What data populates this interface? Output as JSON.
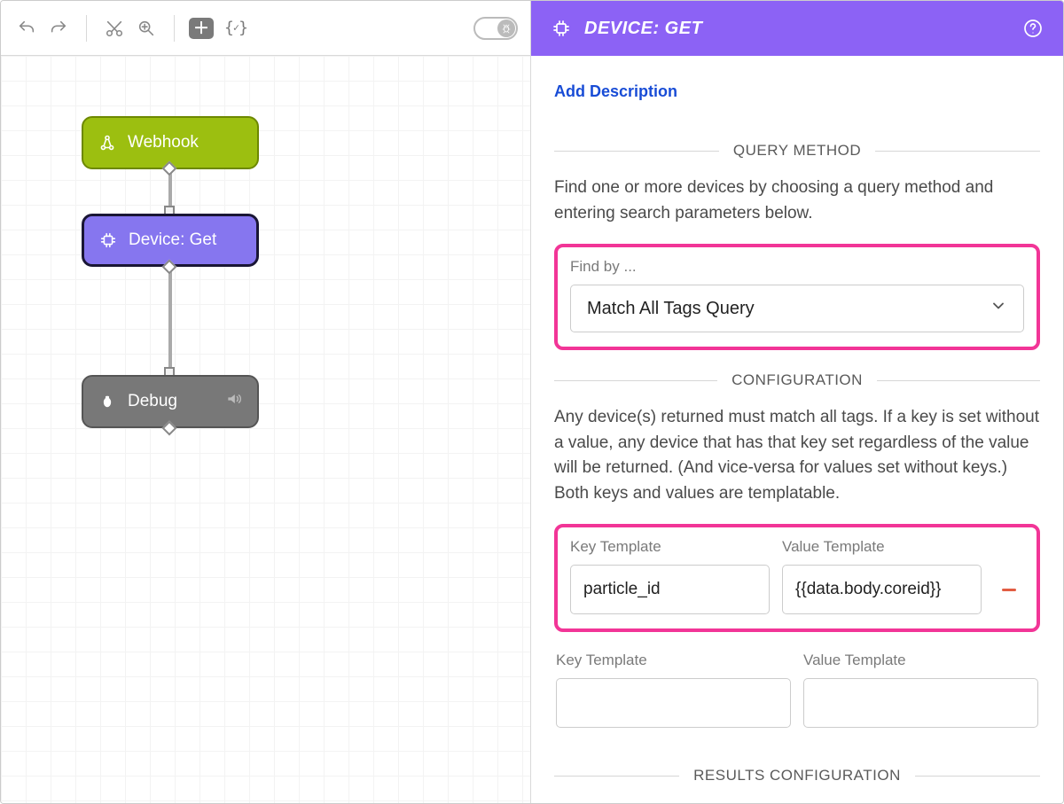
{
  "colors": {
    "accent_purple": "#8c62f5",
    "node_green": "#9cbf10",
    "node_purple": "#8676ef",
    "node_gray": "#787878",
    "highlight_pink": "#f23597",
    "link_blue": "#184cd6"
  },
  "canvas": {
    "nodes": {
      "webhook": {
        "label": "Webhook"
      },
      "device_get": {
        "label": "Device: Get"
      },
      "debug": {
        "label": "Debug"
      }
    }
  },
  "panel": {
    "title": "DEVICE: GET",
    "add_description_label": "Add Description",
    "sections": {
      "query_method": {
        "heading": "QUERY METHOD",
        "help": "Find one or more devices by choosing a query method and entering search parameters below.",
        "find_by_label": "Find by ...",
        "selected": "Match All Tags Query"
      },
      "configuration": {
        "heading": "CONFIGURATION",
        "help": "Any device(s) returned must match all tags. If a key is set without a value, any device that has that key set regardless of the value will be returned. (And vice-versa for values set without keys.) Both keys and values are templatable.",
        "key_label": "Key Template",
        "value_label": "Value Template",
        "rows": [
          {
            "key": "particle_id",
            "value": "{{data.body.coreid}}"
          },
          {
            "key": "",
            "value": ""
          }
        ]
      },
      "results": {
        "heading": "RESULTS CONFIGURATION"
      }
    }
  }
}
